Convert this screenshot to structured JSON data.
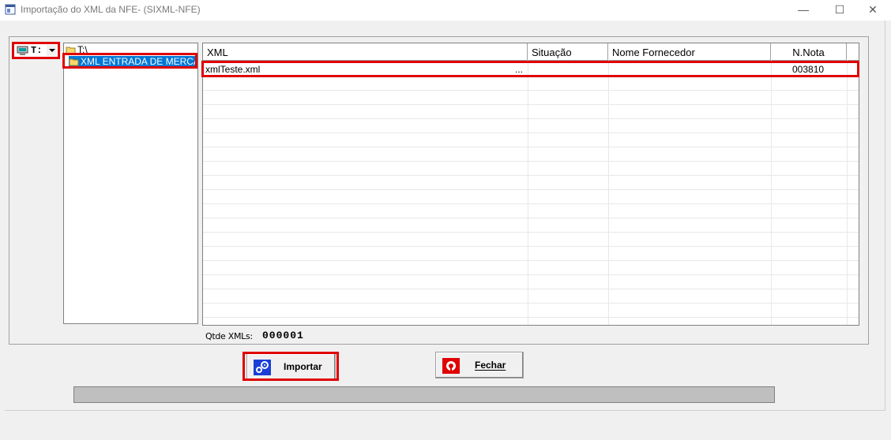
{
  "window": {
    "title": "Importação do XML da NFE- (SIXML-NFE)",
    "minimize_glyph": "—",
    "maximize_glyph": "☐",
    "close_glyph": "✕"
  },
  "drive_selector": {
    "value": "T:",
    "icon": "computer-drive-icon"
  },
  "directory_tree": {
    "root": "T:\\",
    "selected": "XML ENTRADA DE MERCA"
  },
  "grid": {
    "columns": [
      "XML",
      "Situação",
      "Nome Fornecedor",
      "N.Nota"
    ],
    "rows": [
      {
        "xml": "xmlTeste.xml",
        "ellipsis": "...",
        "situacao": "",
        "fornecedor": "",
        "nota": "003810"
      }
    ]
  },
  "footer": {
    "qtde_label": "Qtde XMLs:",
    "qtde_value": "000001"
  },
  "buttons": {
    "import_label": "Importar",
    "close_label": "Fechar"
  },
  "progress": {
    "value": 0
  },
  "colors": {
    "highlight": "#e00000",
    "selection": "#0078d7",
    "import_icon_bg": "#1a3fd6",
    "close_icon_bg": "#e00000"
  }
}
